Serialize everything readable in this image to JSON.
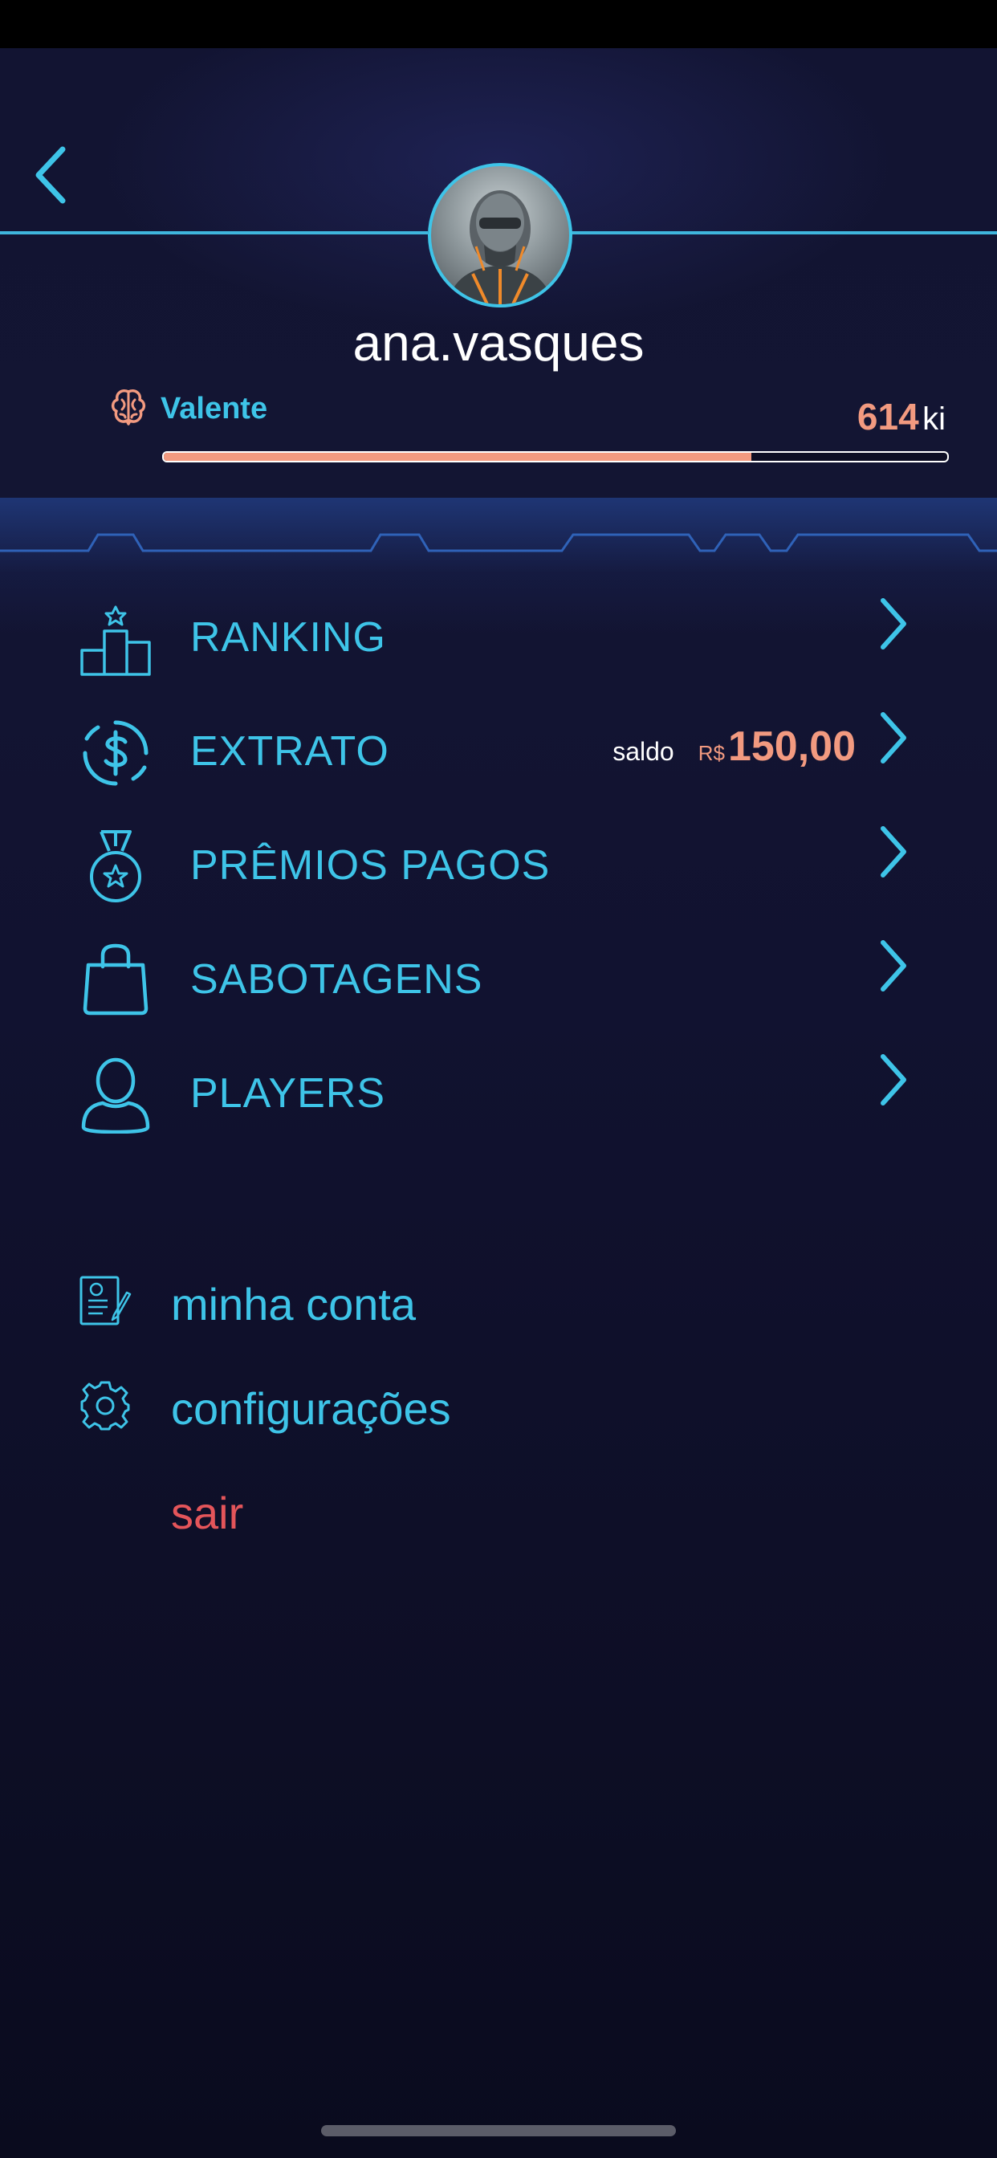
{
  "header": {
    "username": "ana.vasques",
    "rank": {
      "name": "Valente",
      "icon": "brain-icon"
    },
    "ki": {
      "value": "614",
      "unit": "ki"
    },
    "progress_fraction": 0.75
  },
  "menu": [
    {
      "label": "RANKING",
      "icon": "podium-icon"
    },
    {
      "label": "EXTRATO",
      "icon": "dollar-cycle-icon",
      "saldo_label": "saldo",
      "currency": "R$",
      "amount": "150,00"
    },
    {
      "label": "PRÊMIOS PAGOS",
      "icon": "medal-icon"
    },
    {
      "label": "SABOTAGENS",
      "icon": "shopping-bag-icon"
    },
    {
      "label": "PLAYERS",
      "icon": "user-icon"
    }
  ],
  "secondary": [
    {
      "label": "minha conta",
      "icon": "account-document-icon"
    },
    {
      "label": "configurações",
      "icon": "gear-icon"
    },
    {
      "label": "sair"
    }
  ],
  "colors": {
    "accent": "#3ec4e8",
    "highlight": "#f29a80",
    "danger": "#e4555a",
    "background": "#0d0e24"
  }
}
